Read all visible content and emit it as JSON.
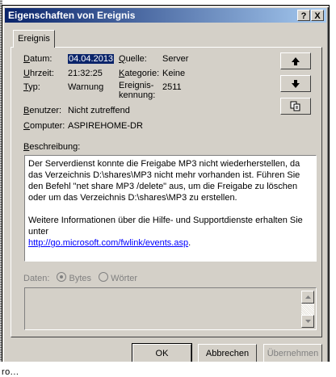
{
  "window": {
    "title": "Eigenschaften von Ereignis",
    "help_glyph": "?",
    "close_glyph": "X"
  },
  "tab": {
    "label": "Ereignis"
  },
  "fields": {
    "datum_label": "Datum:",
    "datum_value": "04.04.2013",
    "uhrzeit_label": "Uhrzeit:",
    "uhrzeit_value": "21:32:25",
    "typ_label": "Typ:",
    "typ_value": "Warnung",
    "benutzer_label": "Benutzer:",
    "benutzer_value": "Nicht zutreffend",
    "computer_label": "Computer:",
    "computer_value": "ASPIREHOME-DR",
    "quelle_label": "Quelle:",
    "quelle_value": "Server",
    "kategorie_label": "Kategorie:",
    "kategorie_value": "Keine",
    "ereigniskennung_label_1": "Ereignis-",
    "ereigniskennung_label_2": "kennung:",
    "ereigniskennung_value": "2511"
  },
  "side_buttons": {
    "up_icon": "arrow-up-icon",
    "down_icon": "arrow-down-icon",
    "copy_icon": "copy-icon"
  },
  "beschreibung": {
    "label": "Beschreibung:",
    "p1": "Der Serverdienst konnte die Freigabe MP3 nicht wiederherstellen, da das Verzeichnis D:\\shares\\MP3 nicht mehr vorhanden ist. Führen Sie den Befehl \"net share MP3 /delete\" aus, um die Freigabe zu löschen oder um das Verzeichnis D:\\shares\\MP3 zu erstellen.",
    "p2_prefix": "Weitere Informationen über die Hilfe- und Supportdienste erhalten Sie unter",
    "link": "http://go.microsoft.com/fwlink/events.asp",
    "p2_suffix": "."
  },
  "daten": {
    "label": "Daten:",
    "bytes": "Bytes",
    "woerter": "Wörter",
    "selected": "Bytes"
  },
  "buttons": {
    "ok": "OK",
    "abbrechen": "Abbrechen",
    "uebernehmen": "Übernehmen"
  },
  "background": {
    "bottom_text": "ro..."
  }
}
